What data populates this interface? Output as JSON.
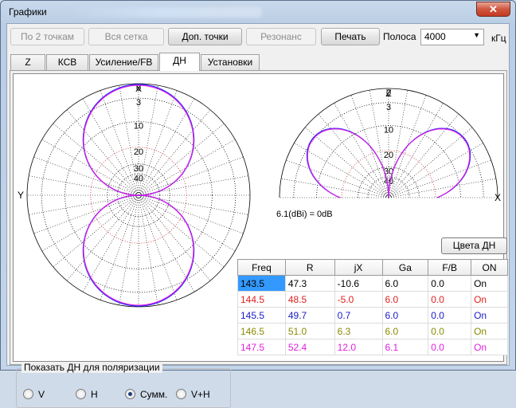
{
  "window": {
    "title": "Графики",
    "close_glyph": "✕"
  },
  "toolbar": {
    "buttons": [
      {
        "label": "По 2 точкам",
        "enabled": false
      },
      {
        "label": "Вся сетка",
        "enabled": false
      },
      {
        "label": "Доп. точки",
        "enabled": true
      },
      {
        "label": "Резонанс",
        "enabled": false
      },
      {
        "label": "Печать",
        "enabled": true
      }
    ],
    "band_label": "Полоса",
    "band_value": "4000",
    "band_unit": "кГц"
  },
  "tabs": [
    {
      "label": "Z",
      "selected": false
    },
    {
      "label": "КСВ",
      "selected": false
    },
    {
      "label": "Усиление/FB",
      "selected": false
    },
    {
      "label": "ДН",
      "selected": true
    },
    {
      "label": "Установки",
      "selected": false
    }
  ],
  "polar_plots": {
    "ring_labels": [
      "0",
      "3",
      "10",
      "20",
      "30",
      "40"
    ],
    "horizontal": {
      "top_axis": "X",
      "left_axis": "Y"
    },
    "vertical": {
      "top_axis": "Z",
      "right_axis": "X"
    },
    "gain_note": "6.1(dBi) = 0dB",
    "colors": {
      "series1": "#2a2aff",
      "series2": "#e020e0",
      "ring": "#000000",
      "ref_ring": "#d03030"
    }
  },
  "colors_button": "Цвета ДН",
  "table": {
    "headers": [
      "Freq",
      "R",
      "jX",
      "Ga",
      "F/B",
      "ON"
    ],
    "rows": [
      {
        "color": "#000000",
        "cells": [
          "143.5",
          "47.3",
          "-10.6",
          "6.0",
          "0.0",
          "On"
        ]
      },
      {
        "color": "#e02020",
        "cells": [
          "144.5",
          "48.5",
          "-5.0",
          "6.0",
          "0.0",
          "On"
        ]
      },
      {
        "color": "#1a1ac8",
        "cells": [
          "145.5",
          "49.7",
          "0.7",
          "6.0",
          "0.0",
          "On"
        ]
      },
      {
        "color": "#8a8a00",
        "cells": [
          "146.5",
          "51.0",
          "6.3",
          "6.0",
          "0.0",
          "On"
        ]
      },
      {
        "color": "#e020e0",
        "cells": [
          "147.5",
          "52.4",
          "12.0",
          "6.1",
          "0.0",
          "On"
        ]
      }
    ]
  },
  "polarization": {
    "title": "Показать ДН для поляризации",
    "options": [
      {
        "label": "V",
        "checked": false
      },
      {
        "label": "H",
        "checked": false
      },
      {
        "label": "Сумм.",
        "checked": true
      },
      {
        "label": "V+H",
        "checked": false
      }
    ]
  }
}
